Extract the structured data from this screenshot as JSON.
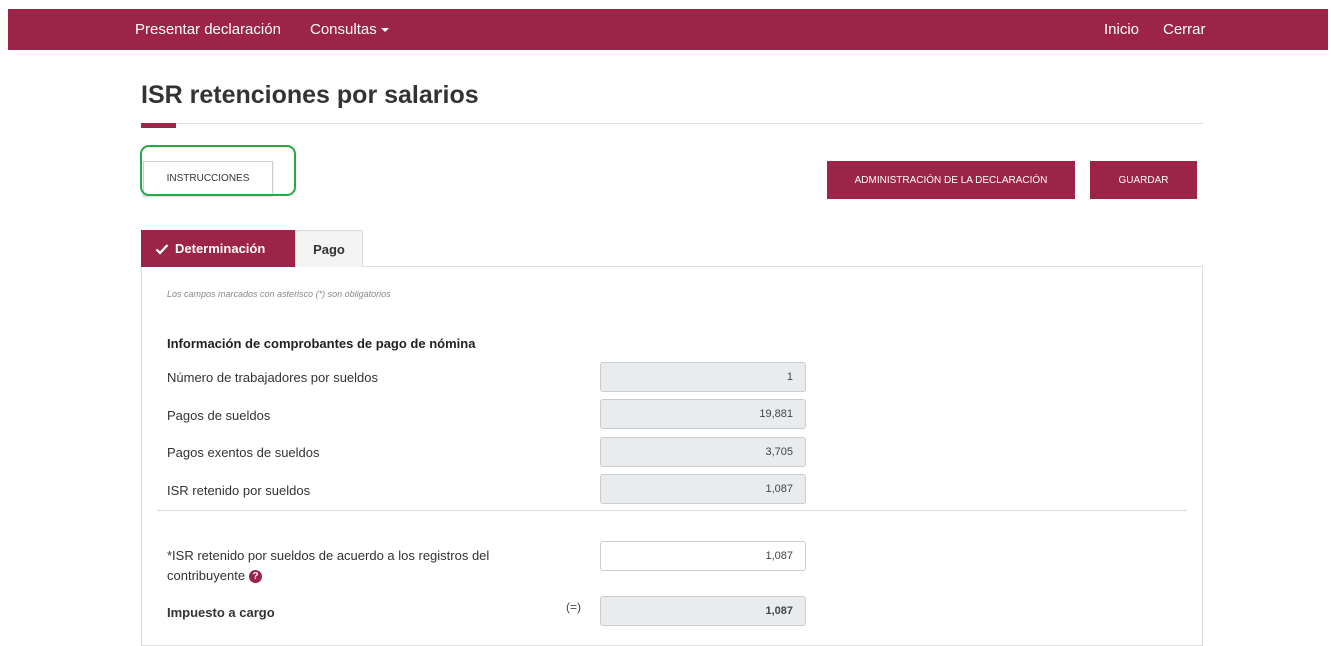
{
  "nav": {
    "presentar": "Presentar declaración",
    "consultas": "Consultas",
    "inicio": "Inicio",
    "cerrar": "Cerrar"
  },
  "page": {
    "title": "ISR retenciones por salarios"
  },
  "buttons": {
    "instrucciones": "INSTRUCCIONES",
    "administracion": "ADMINISTRACIÓN DE LA DECLARACIÓN",
    "guardar": "GUARDAR"
  },
  "tabs": [
    {
      "label": "Determinación",
      "active": true
    },
    {
      "label": "Pago",
      "active": false
    }
  ],
  "form": {
    "required_note": "Los campos marcados con asterisco (*) son obligatorios",
    "section_title": "Información de comprobantes de pago de nómina",
    "fields": [
      {
        "label": "Número de trabajadores por sueldos",
        "value": "1"
      },
      {
        "label": "Pagos de sueldos",
        "value": "19,881"
      },
      {
        "label": "Pagos exentos de sueldos",
        "value": "3,705"
      },
      {
        "label": "ISR retenido por sueldos",
        "value": "1,087"
      }
    ],
    "isr_contribuyente": {
      "label_line1": "*ISR retenido por sueldos de acuerdo a los registros del",
      "label_line2": "contribuyente",
      "value": "1,087"
    },
    "impuesto": {
      "label": "Impuesto a cargo",
      "operator": "(=)",
      "value": "1,087"
    }
  },
  "colors": {
    "brand": "#9d2449",
    "highlight": "#27a844"
  },
  "icons": {
    "tab_check": "check-icon",
    "help": "question-circle-icon",
    "dropdown": "caret-down-icon"
  }
}
